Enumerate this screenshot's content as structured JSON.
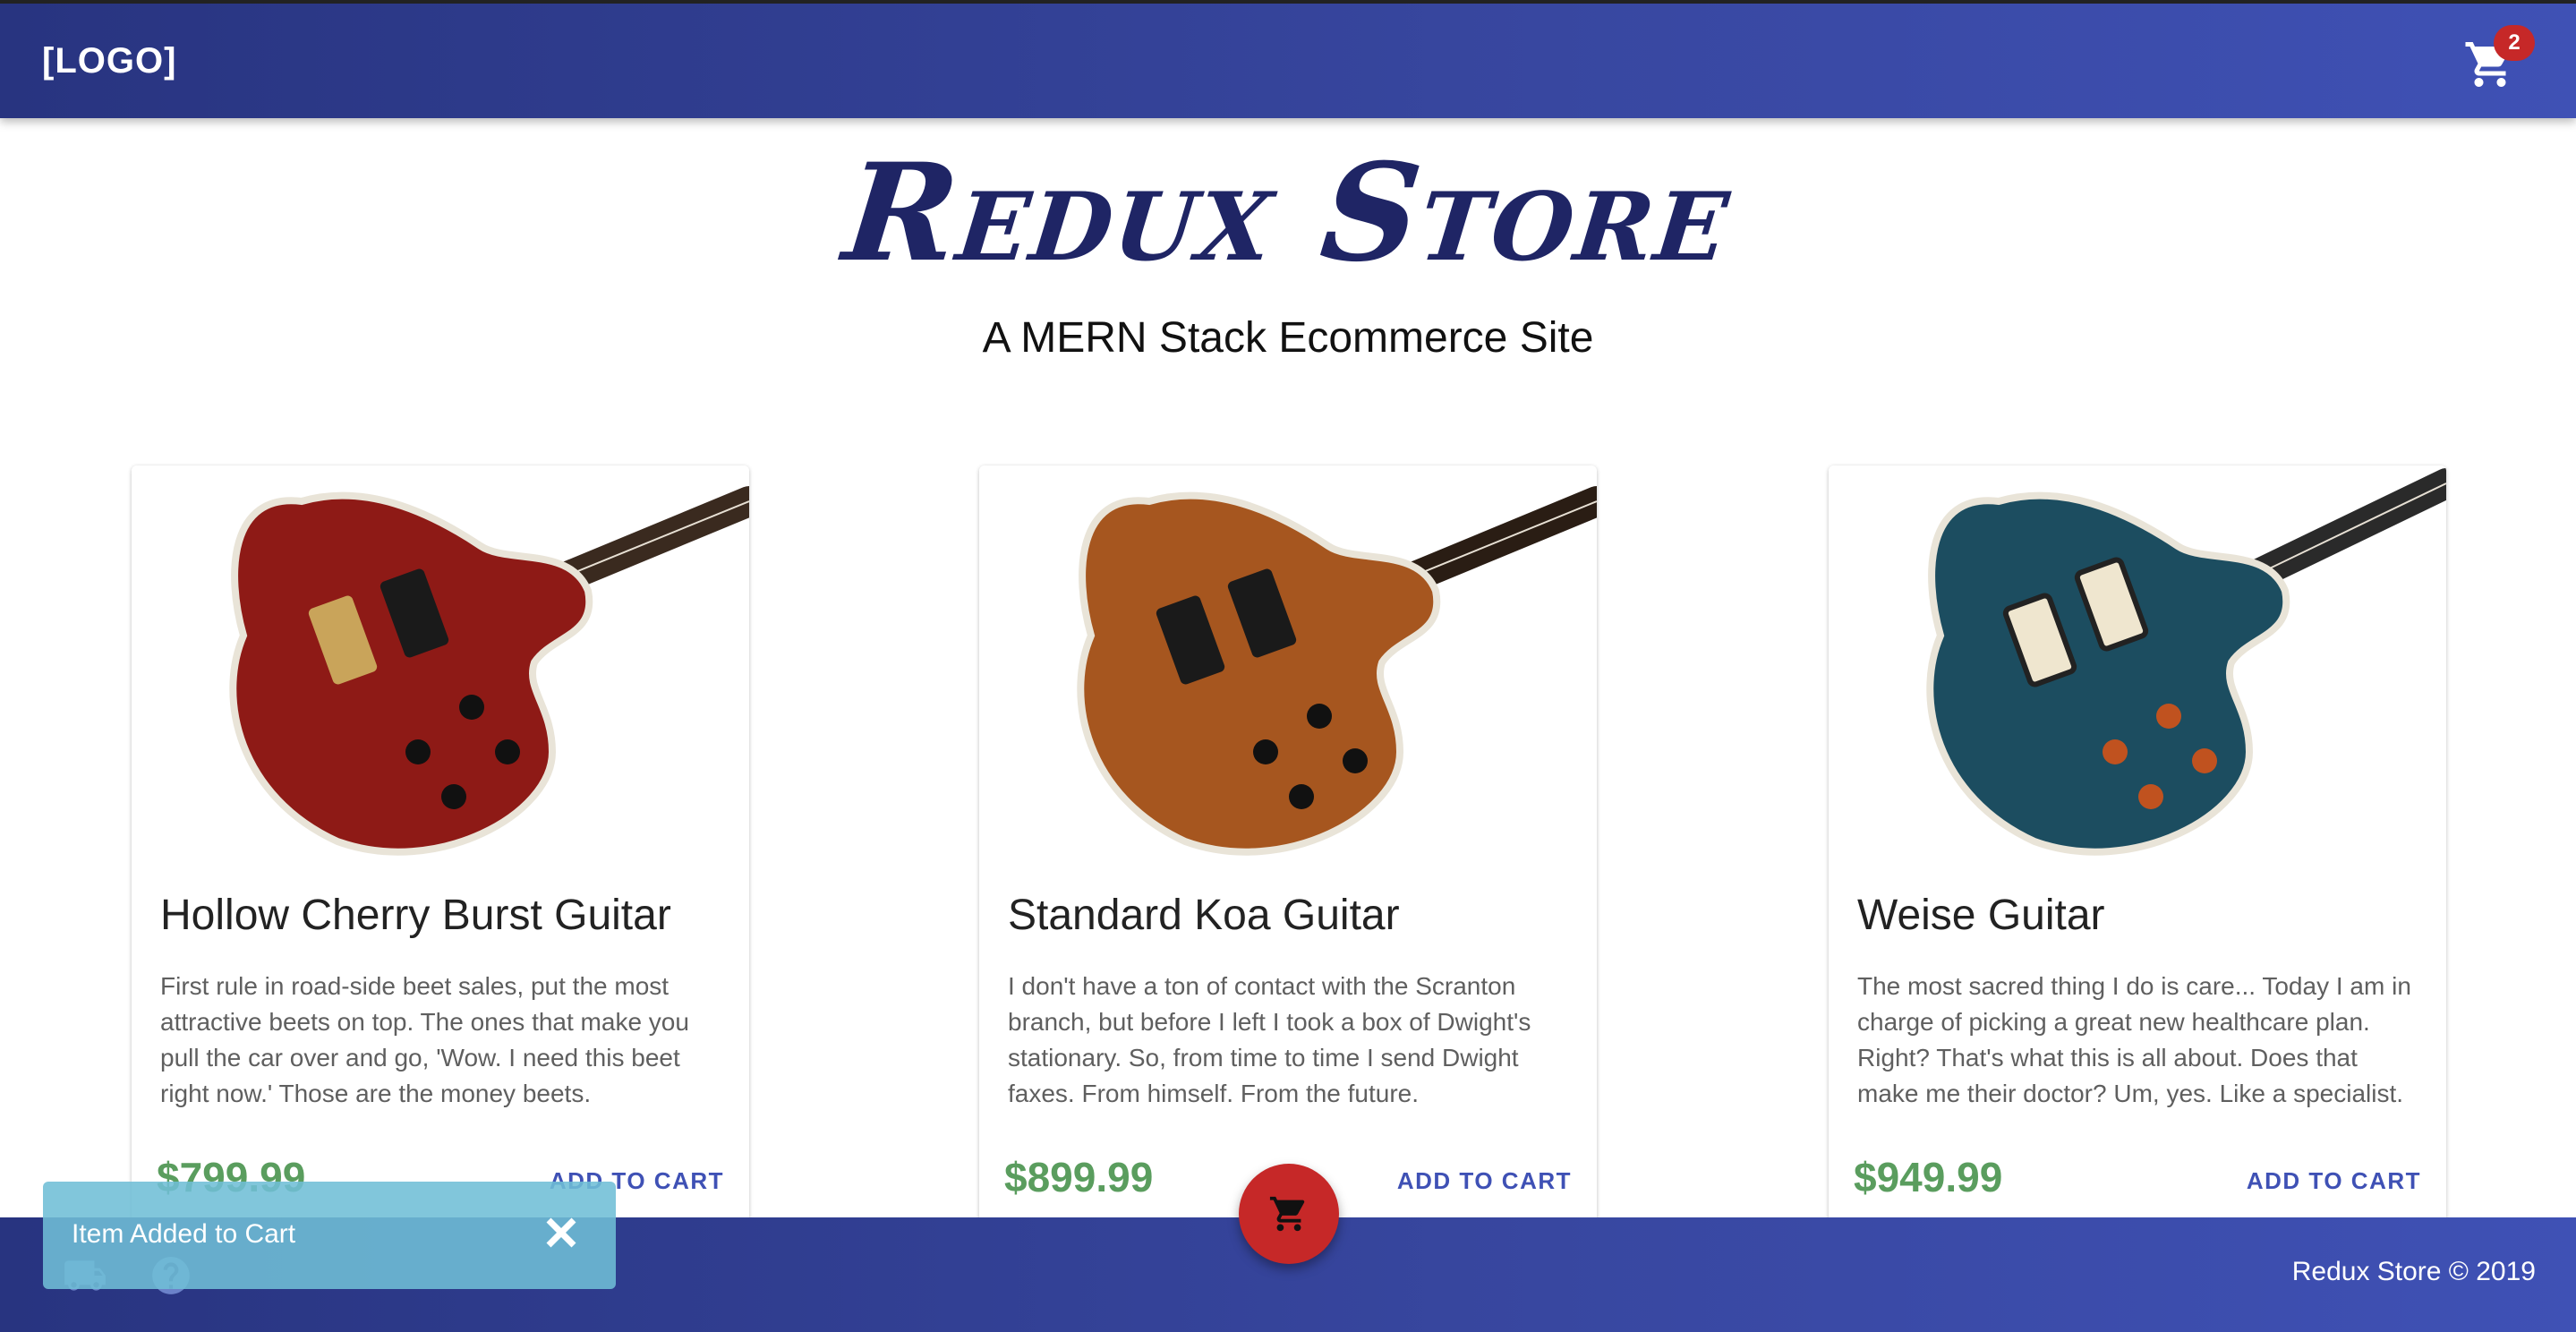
{
  "header": {
    "logo": "[LOGO]",
    "cart_count": "2"
  },
  "hero": {
    "title": "Redux Store",
    "subtitle": "A MERN Stack Ecommerce Site"
  },
  "products": [
    {
      "title": "Hollow Cherry Burst Guitar",
      "description": "First rule in road-side beet sales, put the most attractive beets on top. The ones that make you pull the car over and go, 'Wow. I need this beet right now.' Those are the money beets.",
      "price": "$799.99",
      "add_label": "ADD TO CART",
      "body_color": "#8e1a16"
    },
    {
      "title": "Standard Koa Guitar",
      "description": "I don't have a ton of contact with the Scranton branch, but before I left I took a box of Dwight's stationary. So, from time to time I send Dwight faxes. From himself. From the future.",
      "price": "$899.99",
      "add_label": "ADD TO CART",
      "body_color": "#a6561f"
    },
    {
      "title": "Weise Guitar",
      "description": "The most sacred thing I do is care... Today I am in charge of picking a great new healthcare plan. Right? That's what this is all about. Does that make me their doctor? Um, yes. Like a specialist.",
      "price": "$949.99",
      "add_label": "ADD TO CART",
      "body_color": "#1c4d60"
    }
  ],
  "snackbar": {
    "message": "Item Added to Cart"
  },
  "footer": {
    "text": "Redux Store © 2019"
  },
  "icons": {
    "cart": "shopping-cart-icon",
    "truck": "truck-icon",
    "help": "help-icon",
    "close": "close-icon"
  },
  "colors": {
    "primary": "#3f51b5",
    "primary_dark": "#283480",
    "price_green": "#5a9d5e",
    "accent_red": "#c62828",
    "snackbar": "#70bed6"
  }
}
